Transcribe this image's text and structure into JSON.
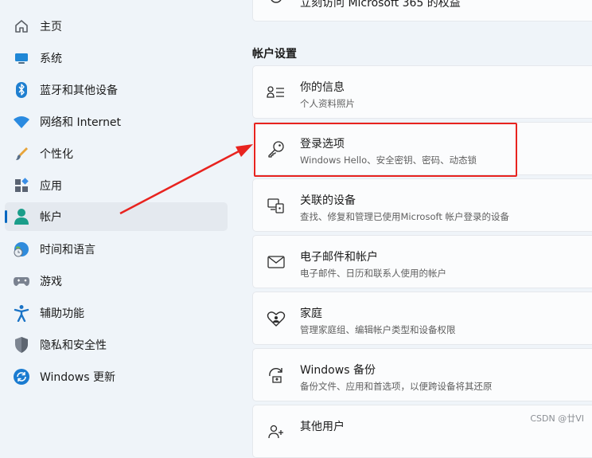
{
  "sidebar": {
    "items": [
      {
        "label": "主页",
        "icon": "home-icon"
      },
      {
        "label": "系统",
        "icon": "monitor-icon"
      },
      {
        "label": "蓝牙和其他设备",
        "icon": "bluetooth-icon"
      },
      {
        "label": "网络和 Internet",
        "icon": "wifi-icon"
      },
      {
        "label": "个性化",
        "icon": "brush-icon"
      },
      {
        "label": "应用",
        "icon": "apps-icon"
      },
      {
        "label": "帐户",
        "icon": "account-icon",
        "active": true
      },
      {
        "label": "时间和语言",
        "icon": "globe-clock-icon"
      },
      {
        "label": "游戏",
        "icon": "gamepad-icon"
      },
      {
        "label": "辅助功能",
        "icon": "accessibility-icon"
      },
      {
        "label": "隐私和安全性",
        "icon": "shield-icon"
      },
      {
        "label": "Windows 更新",
        "icon": "update-icon"
      }
    ]
  },
  "main": {
    "top_partial_text": "立刻访问 Microsoft 365 的权益",
    "section_title": "帐户设置",
    "cards": [
      {
        "title": "你的信息",
        "subtitle": "个人资料照片",
        "icon": "person-info-icon"
      },
      {
        "title": "登录选项",
        "subtitle": "Windows Hello、安全密钥、密码、动态锁",
        "icon": "key-icon"
      },
      {
        "title": "关联的设备",
        "subtitle": "查找、修复和管理已使用Microsoft 帐户登录的设备",
        "icon": "linked-devices-icon"
      },
      {
        "title": "电子邮件和帐户",
        "subtitle": "电子邮件、日历和联系人使用的帐户",
        "icon": "mail-icon"
      },
      {
        "title": "家庭",
        "subtitle": "管理家庭组、编辑帐户类型和设备权限",
        "icon": "family-heart-icon"
      },
      {
        "title": "Windows 备份",
        "subtitle": "备份文件、应用和首选项，以便跨设备将其还原",
        "icon": "backup-icon"
      },
      {
        "title": "其他用户",
        "subtitle": "",
        "icon": "other-users-icon"
      }
    ]
  },
  "watermark": "CSDN @廿VI",
  "colors": {
    "accent": "#0067c0",
    "annotation": "#e8231f",
    "background": "#eff4f9"
  }
}
